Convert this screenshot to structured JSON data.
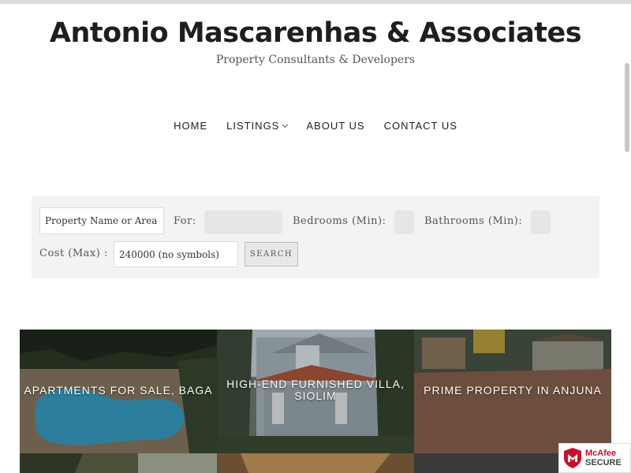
{
  "site": {
    "title": "Antonio Mascarenhas & Associates",
    "tagline": "Property Consultants & Developers"
  },
  "nav": {
    "items": [
      {
        "label": "HOME"
      },
      {
        "label": "LISTINGS",
        "has_dropdown": true
      },
      {
        "label": "ABOUT US"
      },
      {
        "label": "CONTACT US"
      }
    ]
  },
  "search": {
    "property_placeholder": "Property Name or Area",
    "for_label": "For:",
    "bedrooms_label": "Bedrooms (Min):",
    "bathrooms_label": "Bathrooms (Min):",
    "cost_label": "Cost (Max) :",
    "cost_placeholder": "240000 (no symbols)",
    "button_label": "SEARCH"
  },
  "listings": [
    {
      "title": "APARTMENTS FOR SALE, BAGA"
    },
    {
      "title": "HIGH-END FURNISHED VILLA,\nSIOLIM"
    },
    {
      "title": "PRIME PROPERTY IN ANJUNA"
    }
  ],
  "badge": {
    "line1": "McAfee",
    "line2": "SECURE"
  },
  "colors": {
    "title": "#1e1e1e",
    "panel_bg": "#f3f3f3",
    "badge_red": "#c8102e"
  }
}
